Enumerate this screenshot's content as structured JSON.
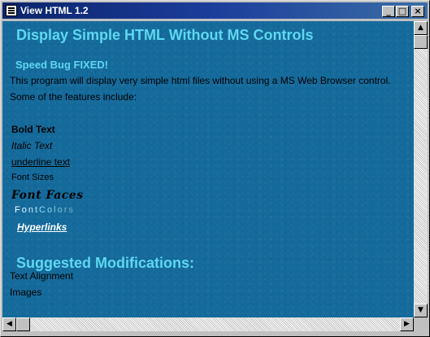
{
  "window": {
    "title": "View HTML 1.2",
    "icons": {
      "app": "document-icon",
      "minimize": "minimize-icon",
      "maximize": "maximize-icon",
      "close": "close-icon"
    }
  },
  "page": {
    "heading": "Display Simple HTML Without MS Controls",
    "subheading": "Speed Bug FIXED!",
    "intro": "This program will display very simple html files without using a MS Web Browser control.",
    "features_intro": "Some of the features include:",
    "bold_text": "Bold Text",
    "italic_text": "Italic Text",
    "underline_text": "underline text",
    "font_sizes": "Font Sizes",
    "font_faces": "Font Faces",
    "font_colors_letters": [
      "F",
      "o",
      "n",
      "t",
      "C",
      "o",
      "l",
      "o",
      "r",
      "s"
    ],
    "font_colors_palette": [
      "#ffffff",
      "#dff6ff",
      "#c6ecff",
      "#b0e4f8",
      "#98d8ee",
      "#8fcfe6",
      "#86c6dd",
      "#7dbed6",
      "#74b4cc",
      "#6aa9c2"
    ],
    "hyperlinks": "Hyperlinks",
    "suggested_heading": "Suggested Modifications:",
    "mod_1": "Text Alignment",
    "mod_2": "Images"
  },
  "colors": {
    "background": "#146a9b",
    "heading": "#5ed8f0",
    "link": "#ffffff"
  }
}
